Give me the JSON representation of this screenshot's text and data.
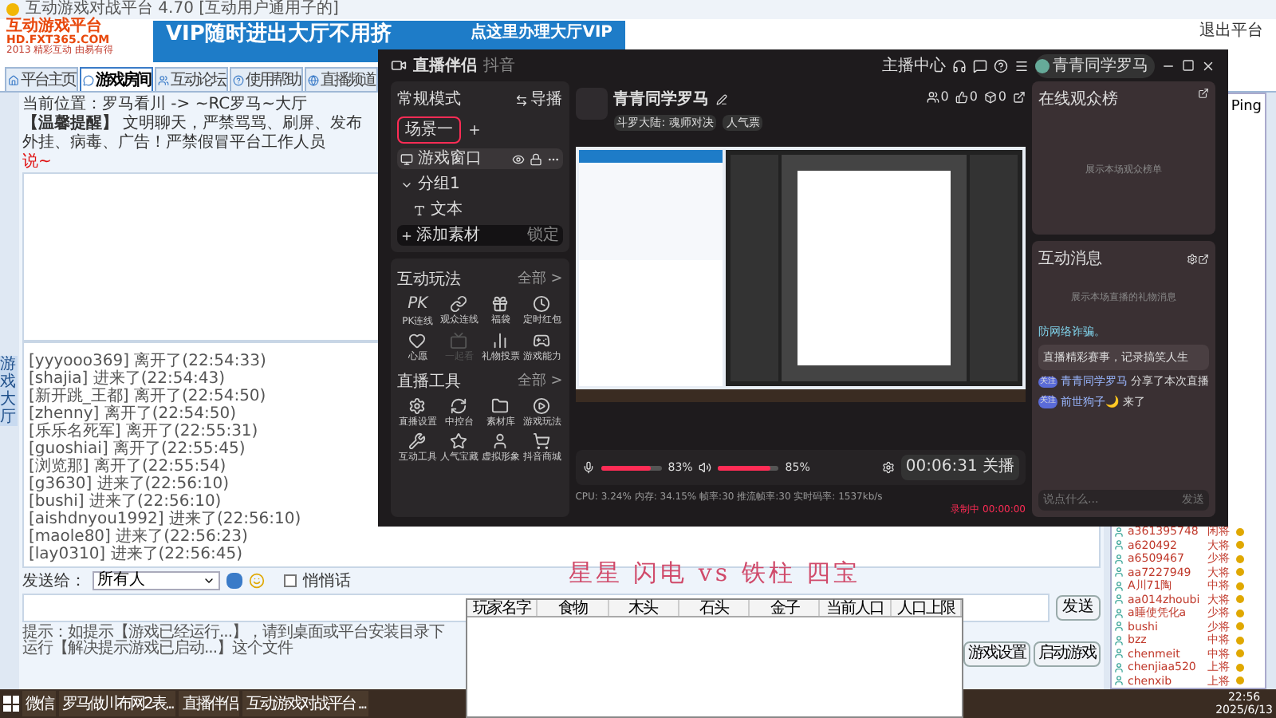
{
  "main_window": {
    "title": "互动游戏对战平台 4.70 [互动用户通用子的]",
    "logo": {
      "title": "互动游戏平台",
      "url": "HD.FXT365.COM",
      "slogan": "2013 精彩互动 由易有得"
    },
    "banner": {
      "left": "VIP随时进出大厅不用挤",
      "right": "点这里办理大厅VIP"
    },
    "exit": "退出平台",
    "tabs": [
      {
        "label": "平台主页",
        "selected": false
      },
      {
        "label": "游戏房间",
        "selected": true
      },
      {
        "label": "互动论坛",
        "selected": false
      },
      {
        "label": "使用帮助",
        "selected": false
      },
      {
        "label": "直播频道",
        "selected": false
      }
    ],
    "location": "当前位置：罗马看川 -> ~RC罗马~大厅",
    "notice": "**【温馨提醒】** 文明聊天，严禁骂骂、刷屏、发布外挂、病毒、广告！严禁假冒平台工作人员",
    "notice_mark": "说~",
    "side_tab": "游戏大厅",
    "messages": [
      "[yyyooo369] 离开了(22:54:33)",
      "[shajia] 进来了(22:54:43)",
      "[新开跳_王都] 离开了(22:54:50)",
      "[zhenny] 离开了(22:54:50)",
      "[乐乐名死军] 离开了(22:55:31)",
      "[guoshiai] 离开了(22:55:45)",
      "[浏览那] 离开了(22:55:54)",
      "[g3630] 进来了(22:56:10)",
      "[bushi] 进来了(22:56:10)",
      "[aishdnyou1992] 进来了(22:56:10)",
      "[maole80] 进来了(22:56:23)",
      "[lay0310] 进来了(22:56:45)"
    ],
    "send_to_label": "发送给：",
    "send_to_value": "所有人",
    "whisper": {
      "label": "悄悄话",
      "checked": false
    },
    "send_button": "发送",
    "hint": "提示：如提示【游戏已经运行...】，请到桌面或平台安装目录下运行【解决提示游戏已启动...】这个文件",
    "buttons": [
      "游戏设置",
      "启动游戏"
    ],
    "user_list": {
      "column": "Ping",
      "users": [
        {
          "name": "a361395748",
          "rank": "闲将"
        },
        {
          "name": "a620492",
          "rank": "大将"
        },
        {
          "name": "a6509467",
          "rank": "少将"
        },
        {
          "name": "aa7227949",
          "rank": "大将"
        },
        {
          "name": "A川71陶",
          "rank": "中将"
        },
        {
          "name": "aa014zhoubi",
          "rank": "大将"
        },
        {
          "name": "a睡使凭化a",
          "rank": "少将"
        },
        {
          "name": "bushi",
          "rank": "少将"
        },
        {
          "name": "bzz",
          "rank": "中将"
        },
        {
          "name": "chenmeit",
          "rank": "中将"
        },
        {
          "name": "chenjiaa520",
          "rank": "上将"
        },
        {
          "name": "chenxib",
          "rank": "上将"
        }
      ]
    }
  },
  "stream_window": {
    "app_name": "直播伴侣",
    "platform": "抖音",
    "anchor_center": "主播中心",
    "user": "青青同学罗马",
    "mode": "常规模式",
    "director": "导播",
    "scene": "场景一",
    "sources": [
      {
        "label": "游戏窗口",
        "kind": "source",
        "selected": true
      },
      {
        "label": "分组1",
        "kind": "group",
        "selected": false
      },
      {
        "label": "文本",
        "kind": "text",
        "selected": false
      }
    ],
    "add_source": "添加素材",
    "lock": "锁定",
    "sections": [
      {
        "title": "互动玩法",
        "more": "全部 >",
        "items": [
          {
            "label": "PK连线",
            "kind": "glyph",
            "glyph": "PK",
            "disabled": false
          },
          {
            "label": "观众连线",
            "kind": "icon",
            "disabled": false
          },
          {
            "label": "福袋",
            "kind": "icon",
            "disabled": false
          },
          {
            "label": "定时红包",
            "kind": "icon",
            "disabled": false
          },
          {
            "label": "心愿",
            "kind": "icon",
            "disabled": false
          },
          {
            "label": "一起看",
            "kind": "icon",
            "disabled": true
          },
          {
            "label": "礼物投票",
            "kind": "icon",
            "disabled": false
          },
          {
            "label": "游戏能力",
            "kind": "icon",
            "disabled": false
          }
        ]
      },
      {
        "title": "直播工具",
        "more": "全部 >",
        "items": [
          {
            "label": "直播设置",
            "kind": "icon",
            "disabled": false
          },
          {
            "label": "中控台",
            "kind": "icon",
            "disabled": false
          },
          {
            "label": "素材库",
            "kind": "icon",
            "disabled": false
          },
          {
            "label": "游戏玩法",
            "kind": "icon",
            "disabled": false
          },
          {
            "label": "互动工具",
            "kind": "icon",
            "disabled": false
          },
          {
            "label": "人气宝藏",
            "kind": "icon",
            "disabled": false
          },
          {
            "label": "虚拟形象",
            "kind": "icon",
            "disabled": false
          },
          {
            "label": "抖音商城",
            "kind": "icon",
            "disabled": false
          }
        ]
      }
    ],
    "room_title": "青青同学罗马",
    "tags": [
      "斗罗大陆: 魂师对决",
      "人气票"
    ],
    "stats": [
      "0",
      "0",
      "0"
    ],
    "mic": {
      "level": 0.83,
      "reading": "83%"
    },
    "speaker": {
      "level": 0.85,
      "reading": "85%"
    },
    "live_button": "00:06:31 关播",
    "status": "CPU: 3.24%  内存: 34.15%  帧率:30  推流帧率:30  实时码率: 1537kb/s",
    "recording": "录制中 00:00:00",
    "audience": {
      "title": "在线观众榜",
      "empty": "展示本场观众榜单"
    },
    "messages_panel": {
      "title": "互动消息",
      "empty": "展示本场直播的礼物消息",
      "notice": "防网络诈骗。",
      "system": "直播精彩赛事，记录搞笑人生",
      "chat": [
        {
          "badge": "关注",
          "user": "青青同学罗马",
          "text": "分享了本次直播"
        },
        {
          "badge": "关注",
          "user": "前世狗子🌙",
          "text": "来了"
        }
      ],
      "placeholder": "说点什么...",
      "send": "发送"
    }
  },
  "score_window": {
    "title": "星星 闪电 vs 铁柱 四宝",
    "columns": [
      "玩家名字",
      "食物",
      "木头",
      "石头",
      "金子",
      "当前人口",
      "人口上限"
    ]
  },
  "taskbar": {
    "apps": [
      "微信",
      "罗马做川布网2表...",
      "直播伴侣",
      "互动游戏对战平台 ..."
    ],
    "time": "22:56",
    "date": "2025/6/13"
  }
}
